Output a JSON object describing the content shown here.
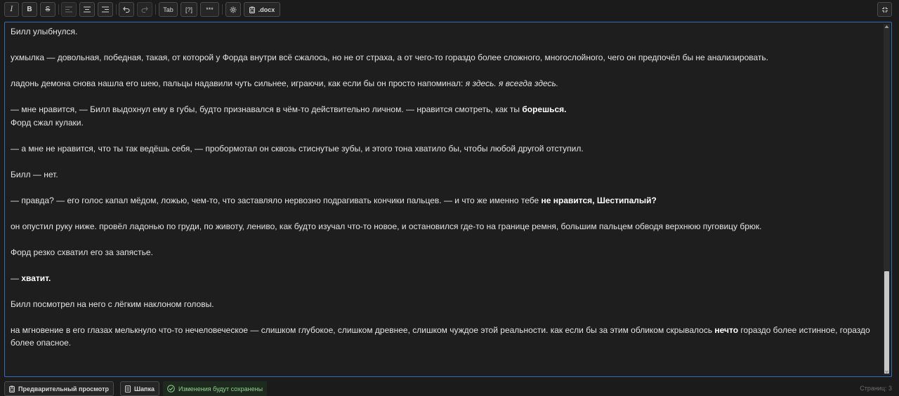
{
  "toolbar": {
    "italic": "I",
    "bold": "B",
    "strike": "S",
    "tab": "Tab",
    "help": "[?]",
    "separator": "***",
    "docx": ".docx"
  },
  "editor": {
    "paragraphs": [
      "Билл улыбнулся.",
      "ухмылка — довольная, победная, такая, от которой у Форда внутри всё сжалось, но не от страха, а от чего-то гораздо более сложного, многослойного, чего он предпочёл бы не анализировать.",
      "ладонь демона снова нашла его шею, пальцы надавили чуть сильнее, играючи, как если бы он просто напоминал:",
      "я здесь. я всегда здесь.",
      "— мне нравится, — Билл выдохнул ему в губы, будто признавался в чём-то действительно личном. — нравится смотреть, как ты",
      "борешься.",
      "Форд сжал кулаки.",
      "— а мне не нравится, что ты так ведёшь себя, — пробормотал он сквозь стиснутые зубы, и этого тона хватило бы, чтобы любой другой отступил.",
      "Билл — нет.",
      "— правда? — его голос капал мёдом, ложью, чем-то, что заставляло нервозно подрагивать кончики пальцев. — и что же именно тебе",
      "не нравится, Шестипалый?",
      "он опустил руку ниже. провёл ладонью по груди, по животу, лениво, как будто изучал что-то новое, и остановился где-то на границе ремня, большим пальцем обводя верхнюю пуговицу брюк.",
      "Форд резко схватил его за запястье.",
      "—",
      "хватит.",
      "Билл посмотрел на него с лёгким наклоном головы.",
      "на мгновение в его глазах мелькнуло что-то нечеловеческое — слишком глубокое, слишком древнее, слишком чуждое этой реальности. как если бы за этим обликом скрывалось",
      "нечто",
      "гораздо более истинное, гораздо более опасное."
    ]
  },
  "statusbar": {
    "preview": "Предварительный просмотр",
    "header": "Шапка",
    "saved": "Изменения будут сохранены",
    "pages": "Страниц: 3"
  },
  "colors": {
    "background": "#1b1b1b",
    "editor_border": "#2f6fbd",
    "saved_text": "#8fd18f"
  }
}
